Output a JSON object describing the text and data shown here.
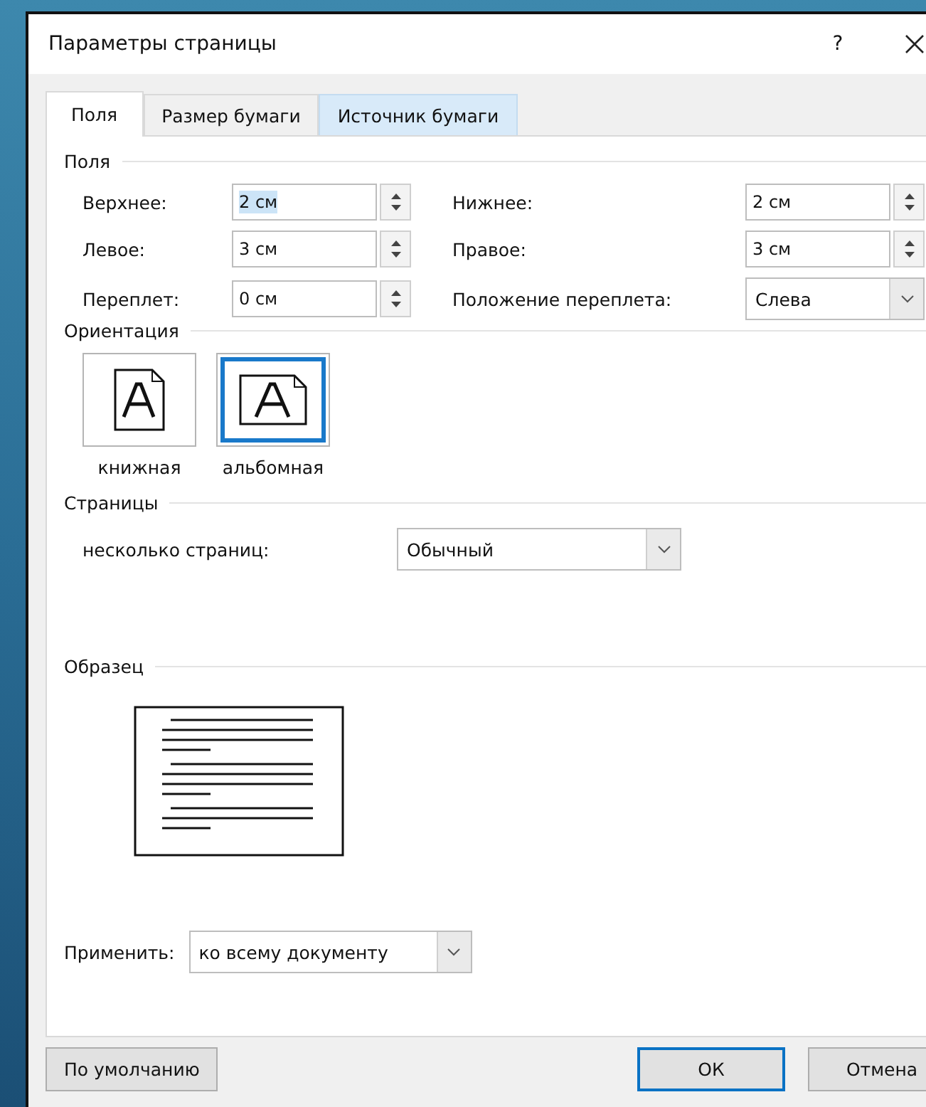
{
  "window": {
    "title": "Параметры страницы",
    "help": "?"
  },
  "tabs": [
    {
      "label": "Поля",
      "selected": true,
      "hovered": false
    },
    {
      "label": "Размер бумаги",
      "selected": false,
      "hovered": false
    },
    {
      "label": "Источник бумаги",
      "selected": false,
      "hovered": true
    }
  ],
  "margins": {
    "title": "Поля",
    "fields": [
      {
        "kind": "spin",
        "label": "Верхнее:",
        "value": "2 см",
        "text_selected": true
      },
      {
        "kind": "spin",
        "label": "Нижнее:",
        "value": "2 см"
      },
      {
        "kind": "spin",
        "label": "Левое:",
        "value": "3 см"
      },
      {
        "kind": "spin",
        "label": "Правое:",
        "value": "3 см"
      },
      {
        "kind": "spin",
        "label": "Переплет:",
        "value": "0 см"
      },
      {
        "kind": "dropdown",
        "label": "Положение переплета:",
        "value": "Слева"
      }
    ]
  },
  "orientation": {
    "title": "Ориентация",
    "options": [
      {
        "kind": "portrait",
        "label": "книжная",
        "selected": false
      },
      {
        "kind": "landscape",
        "label": "альбомная",
        "selected": true
      }
    ]
  },
  "pages": {
    "title": "Страницы",
    "label": "несколько страниц:",
    "value": "Обычный"
  },
  "preview": {
    "title": "Образец"
  },
  "apply": {
    "label": "Применить:",
    "value": "ко всему документу"
  },
  "buttons": [
    {
      "kind": "left",
      "label": "По умолчанию",
      "default": false
    },
    {
      "kind": "right",
      "label": "ОК",
      "default": true
    },
    {
      "kind": "right",
      "label": "Отмена",
      "default": false
    }
  ]
}
